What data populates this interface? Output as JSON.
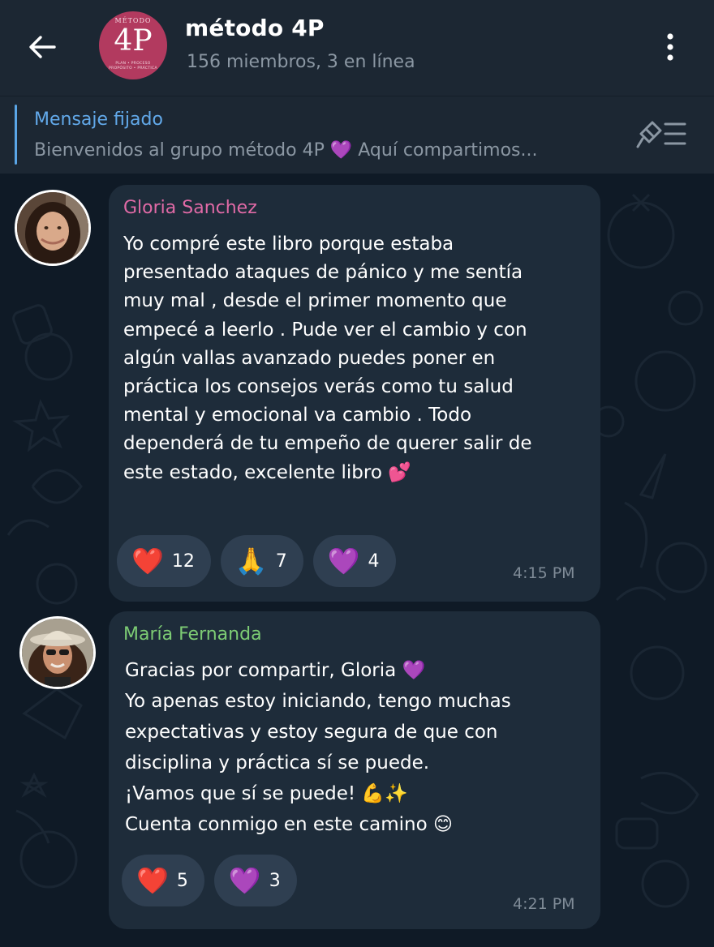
{
  "header": {
    "title": "método 4P",
    "subtitle": "156 miembros, 3 en línea",
    "avatar": {
      "top": "MÉTODO",
      "big": "4P",
      "sub_line1": "PLAN • PROCESO",
      "sub_line2": "PROPÓSITO • PRÁCTICA",
      "color": "#b23a5f"
    },
    "back_icon": "arrow-left-icon",
    "menu_icon": "more-vertical-icon"
  },
  "pinned": {
    "title": "Mensaje fijado",
    "text": "Bienvenidos al grupo método 4P 💜 Aquí compartimos...",
    "icon": "pin-list-icon"
  },
  "messages": [
    {
      "sender": "Gloria Sanchez",
      "sender_color": "#e06aa6",
      "text": "Yo compré este libro porque estaba\npresentado ataques de pánico y me sentía\nmuy mal , desde el primer momento que\nempecé a leerlo . Pude ver el cambio y con\nalgún vallas avanzado puedes poner en\npráctica los consejos verás como tu salud\nmental y emocional va cambio . Todo\ndependerá de tu empeño de querer salir de\neste estado, excelente libro 💕",
      "reactions": [
        {
          "emoji": "❤️",
          "count": "12"
        },
        {
          "emoji": "🙏",
          "count": "7"
        },
        {
          "emoji": "💜",
          "count": "4"
        }
      ],
      "time": "4:15 PM"
    },
    {
      "sender": "María Fernanda",
      "sender_color": "#7dcc74",
      "text": "Gracias por compartir, Gloria 💜\nYo apenas estoy iniciando, tengo muchas\nexpectativas y estoy segura de que con\ndisciplina y práctica sí se puede.\n¡Vamos que sí se puede! 💪✨\nCuenta conmigo en este camino 😊",
      "reactions": [
        {
          "emoji": "❤️",
          "count": "5"
        },
        {
          "emoji": "💜",
          "count": "3"
        }
      ],
      "time": "4:21 PM"
    }
  ],
  "colors": {
    "background": "#0f1a26",
    "header": "#1c2733",
    "bubble": "#1e2c3a",
    "reaction": "#2f3f51",
    "accent": "#62a9ea"
  }
}
